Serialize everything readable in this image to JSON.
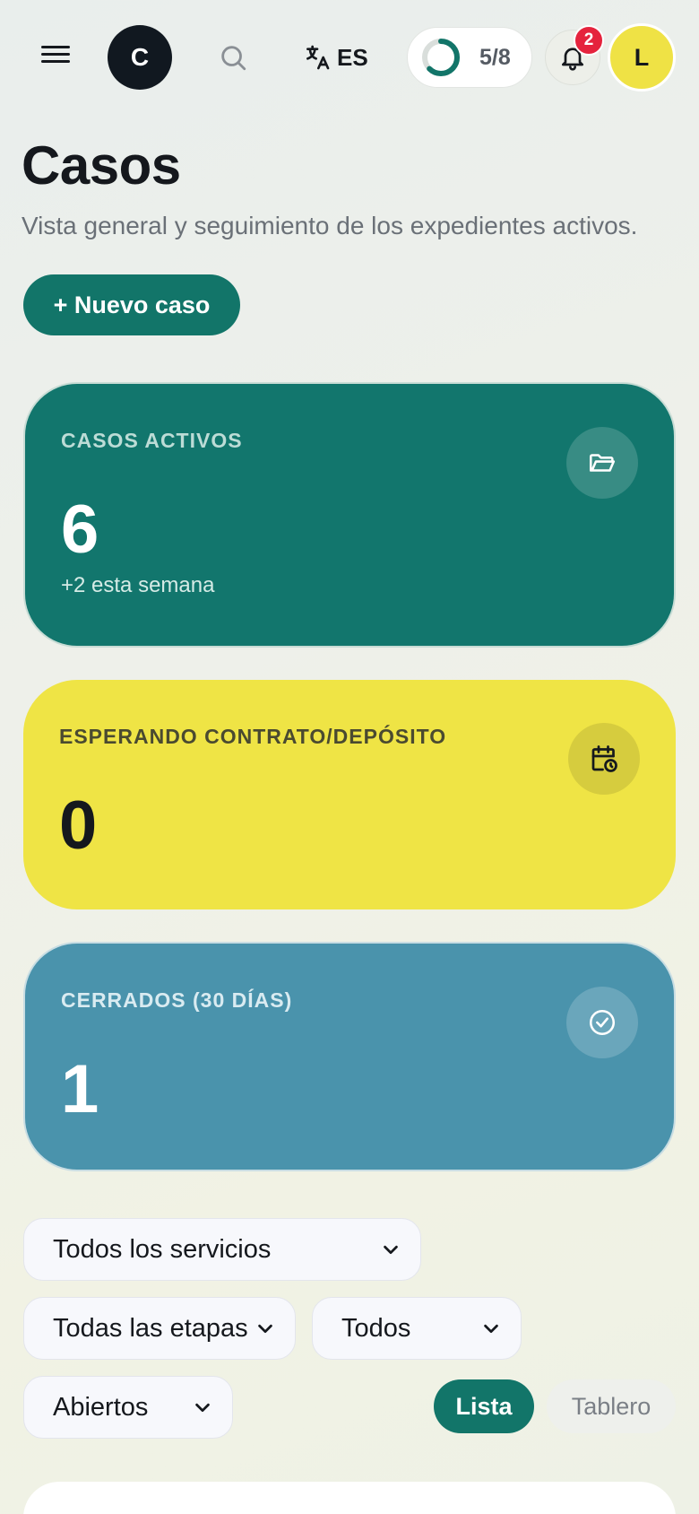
{
  "header": {
    "menu_icon": "hamburger-menu-icon",
    "logo_letter": "C",
    "search_icon": "search-icon",
    "language_icon": "translate-icon",
    "language": "ES",
    "progress": {
      "done": 5,
      "total": 8,
      "label": "5/8",
      "fraction": 0.625
    },
    "notifications_icon": "bell-icon",
    "notifications_count": "2",
    "avatar_letter": "L"
  },
  "page": {
    "title": "Casos",
    "subtitle": "Vista general y seguimiento de los expedientes activos.",
    "new_case_label": "+ Nuevo caso"
  },
  "stats": {
    "active": {
      "label": "CASOS ACTIVOS",
      "value": "6",
      "sub": "+2 esta semana",
      "icon": "folder-open-icon"
    },
    "waiting": {
      "label": "ESPERANDO CONTRATO/DEPÓSITO",
      "value": "0",
      "icon": "calendar-clock-icon"
    },
    "closed": {
      "label": "CERRADOS (30 DÍAS)",
      "value": "1",
      "icon": "check-circle-icon"
    }
  },
  "filters": {
    "service": "Todos los servicios",
    "stage": "Todas las etapas",
    "assignee": "Todos",
    "status": "Abiertos"
  },
  "view_toggle": {
    "list_label": "Lista",
    "board_label": "Tablero",
    "active": "Lista"
  },
  "colors": {
    "primary": "#127569",
    "accent_yellow": "#efe445",
    "closed_blue": "#4a93ac",
    "badge_red": "#e5233d",
    "dark": "#111820"
  }
}
